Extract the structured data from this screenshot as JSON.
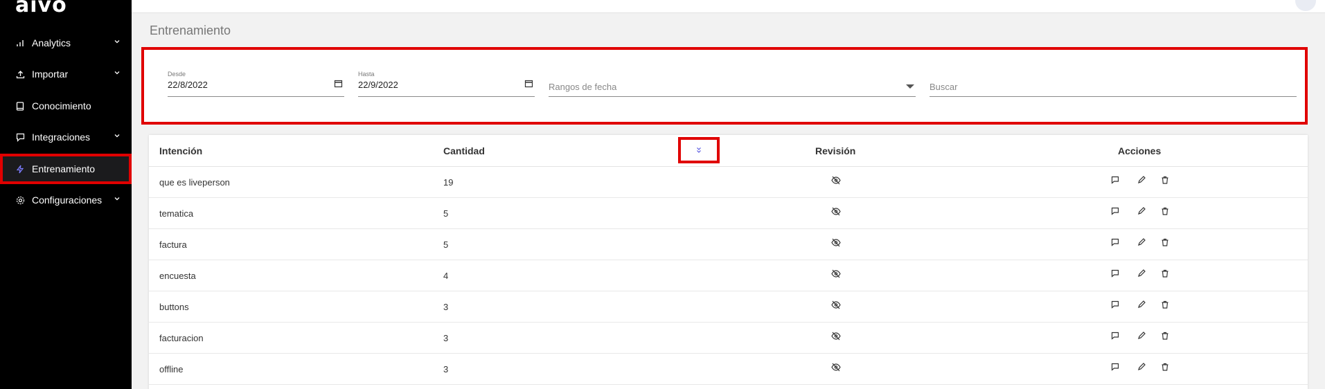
{
  "sidebar": {
    "logo": "aivo",
    "items": [
      {
        "label": "Analytics",
        "icon": "bar-chart-icon",
        "chevron": true
      },
      {
        "label": "Importar",
        "icon": "upload-icon",
        "chevron": true
      },
      {
        "label": "Conocimiento",
        "icon": "book-icon",
        "chevron": false
      },
      {
        "label": "Integraciones",
        "icon": "chat-bubble-icon",
        "chevron": true
      },
      {
        "label": "Entrenamiento",
        "icon": "lightning-icon",
        "chevron": false,
        "active": true
      },
      {
        "label": "Configuraciones",
        "icon": "gear-icon",
        "chevron": true
      }
    ]
  },
  "page": {
    "title": "Entrenamiento"
  },
  "filters": {
    "desde_label": "Desde",
    "desde_value": "22/8/2022",
    "hasta_label": "Hasta",
    "hasta_value": "22/9/2022",
    "rangos_placeholder": "Rangos de fecha",
    "buscar_placeholder": "Buscar"
  },
  "table": {
    "headers": {
      "intencion": "Intención",
      "cantidad": "Cantidad",
      "revision": "Revisión",
      "acciones": "Acciones"
    },
    "rows": [
      {
        "intencion": "que es liveperson",
        "cantidad": "19"
      },
      {
        "intencion": "tematica",
        "cantidad": "5"
      },
      {
        "intencion": "factura",
        "cantidad": "5"
      },
      {
        "intencion": "encuesta",
        "cantidad": "4"
      },
      {
        "intencion": "buttons",
        "cantidad": "3"
      },
      {
        "intencion": "facturacion",
        "cantidad": "3"
      },
      {
        "intencion": "offline",
        "cantidad": "3"
      }
    ]
  },
  "colors": {
    "highlight": "#e00000",
    "sidebar_bg": "#000000",
    "active_icon": "#7c7cff",
    "sort_icon": "#5a5ae0"
  }
}
